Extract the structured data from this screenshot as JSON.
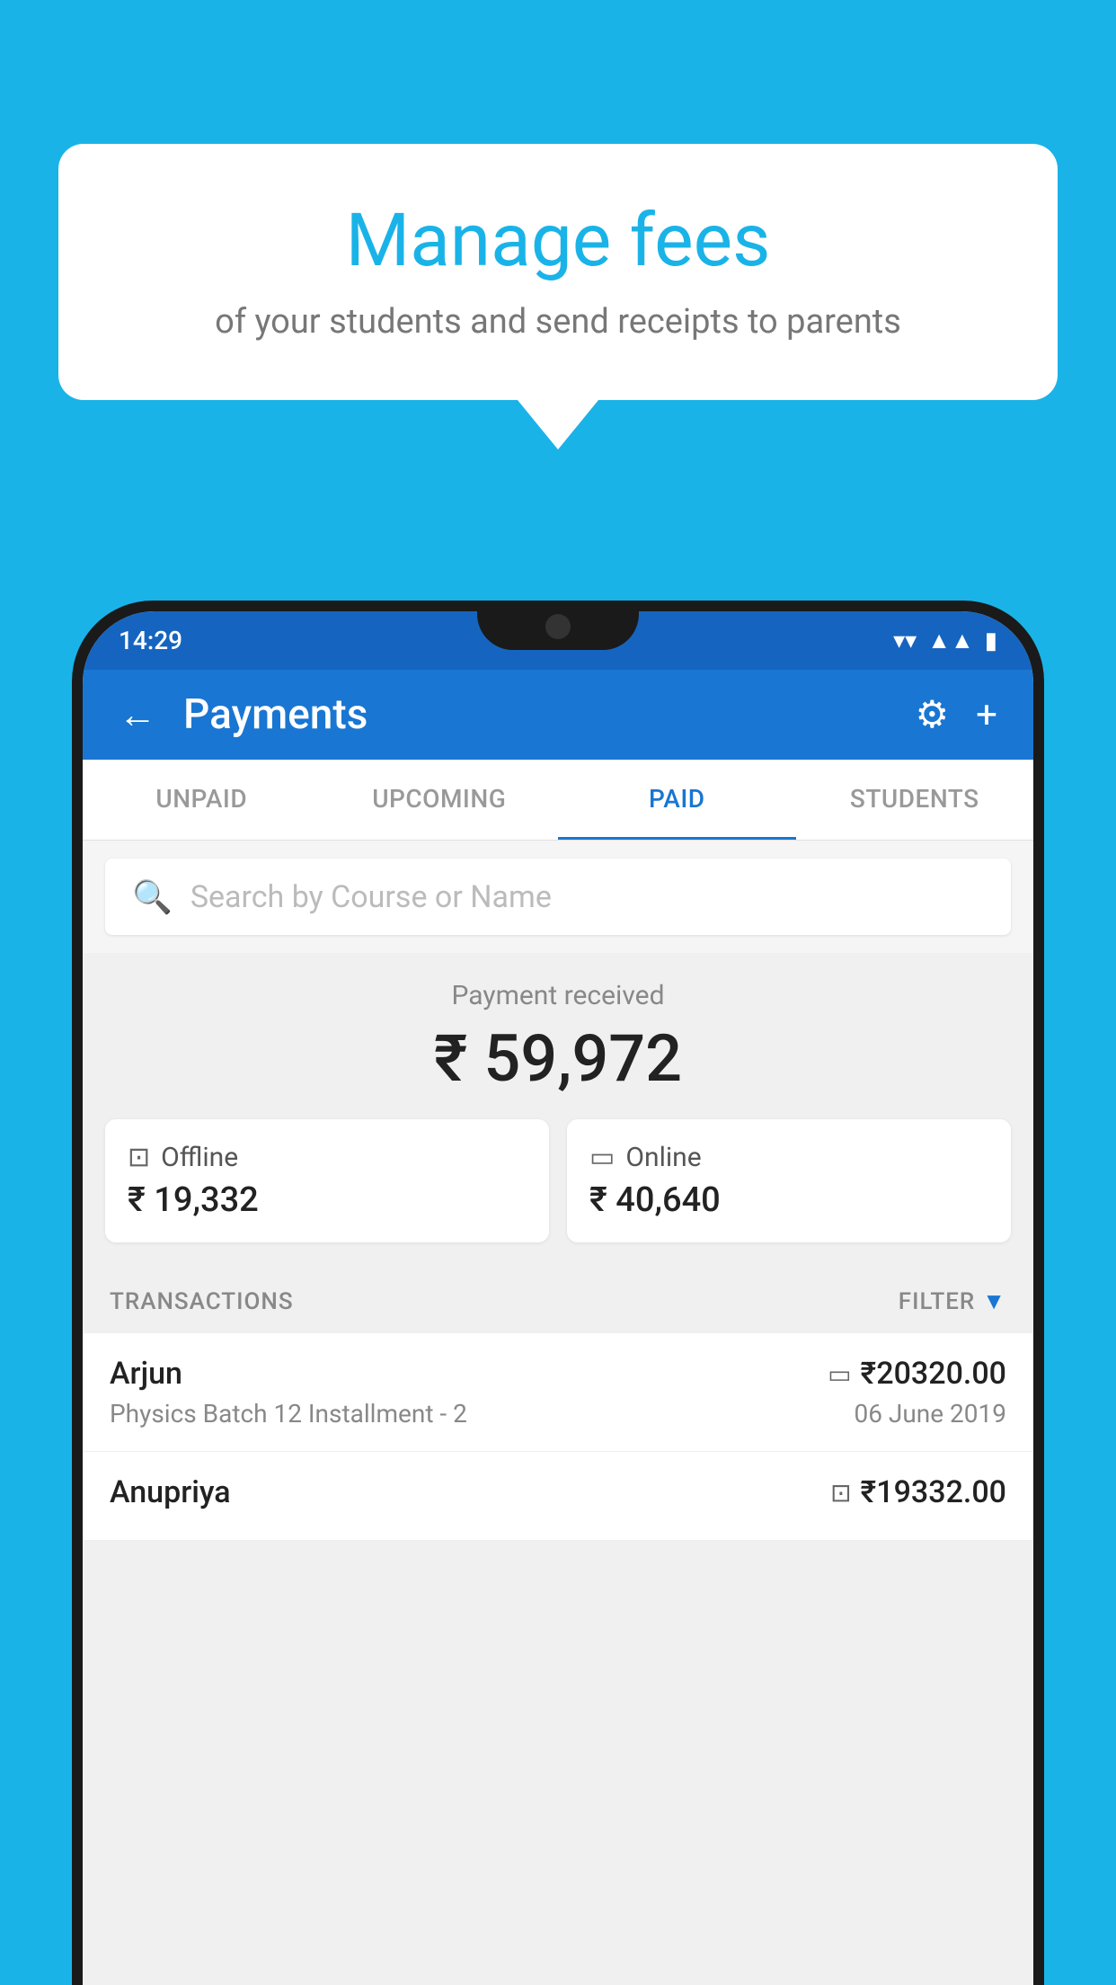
{
  "background_color": "#1ab3e8",
  "speech_bubble": {
    "title": "Manage fees",
    "subtitle": "of your students and send receipts to parents"
  },
  "status_bar": {
    "time": "14:29",
    "wifi": "▼",
    "signal": "▲",
    "battery": "▮"
  },
  "header": {
    "title": "Payments",
    "back_label": "←",
    "settings_label": "⚙",
    "add_label": "+"
  },
  "tabs": [
    {
      "label": "UNPAID",
      "active": false
    },
    {
      "label": "UPCOMING",
      "active": false
    },
    {
      "label": "PAID",
      "active": true
    },
    {
      "label": "STUDENTS",
      "active": false
    }
  ],
  "search": {
    "placeholder": "Search by Course or Name"
  },
  "payment_summary": {
    "label": "Payment received",
    "total": "₹ 59,972",
    "offline": {
      "type": "Offline",
      "amount": "₹ 19,332"
    },
    "online": {
      "type": "Online",
      "amount": "₹ 40,640"
    }
  },
  "transactions_section": {
    "label": "TRANSACTIONS",
    "filter_label": "FILTER"
  },
  "transactions": [
    {
      "name": "Arjun",
      "course": "Physics Batch 12 Installment - 2",
      "amount": "₹20320.00",
      "date": "06 June 2019",
      "payment_type": "online"
    },
    {
      "name": "Anupriya",
      "course": "",
      "amount": "₹19332.00",
      "date": "",
      "payment_type": "offline"
    }
  ]
}
